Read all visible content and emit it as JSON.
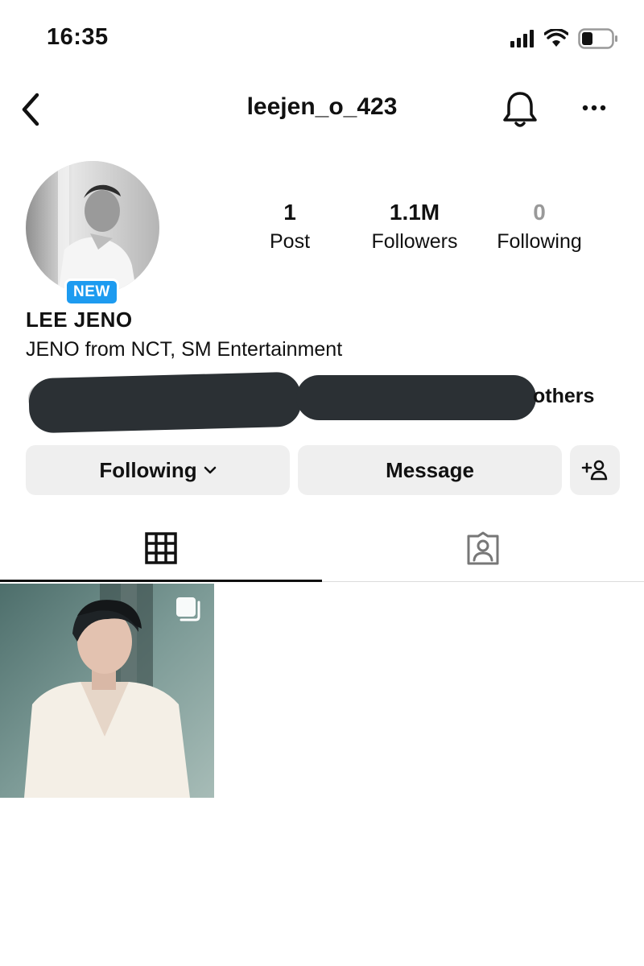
{
  "status_bar": {
    "time": "16:35",
    "icons": [
      "cellular-signal-icon",
      "wifi-icon",
      "battery-icon"
    ]
  },
  "header": {
    "username": "leejen_o_423",
    "icons": [
      "back-icon",
      "bell-icon",
      "more-icon"
    ]
  },
  "profile": {
    "badge": "NEW",
    "display_name": "LEE JENO",
    "bio": "JENO from NCT, SM Entertainment",
    "stats": {
      "posts": {
        "value": "1",
        "label": "Post"
      },
      "followers": {
        "value": "1.1M",
        "label": "Followers"
      },
      "following": {
        "value": "0",
        "label": "Following"
      }
    },
    "followed_by_suffix": "others"
  },
  "actions": {
    "following_label": "Following",
    "message_label": "Message",
    "add_user_icon": "add-person-icon"
  },
  "tabs": [
    {
      "icon": "grid-icon",
      "active": true
    },
    {
      "icon": "tagged-icon",
      "active": false
    }
  ],
  "posts": [
    {
      "multi": true,
      "icon": "multiple-photos-icon"
    }
  ],
  "colors": {
    "accent_blue": "#1d9bf0",
    "button_bg": "#efefef",
    "redaction": "#2b3034"
  }
}
